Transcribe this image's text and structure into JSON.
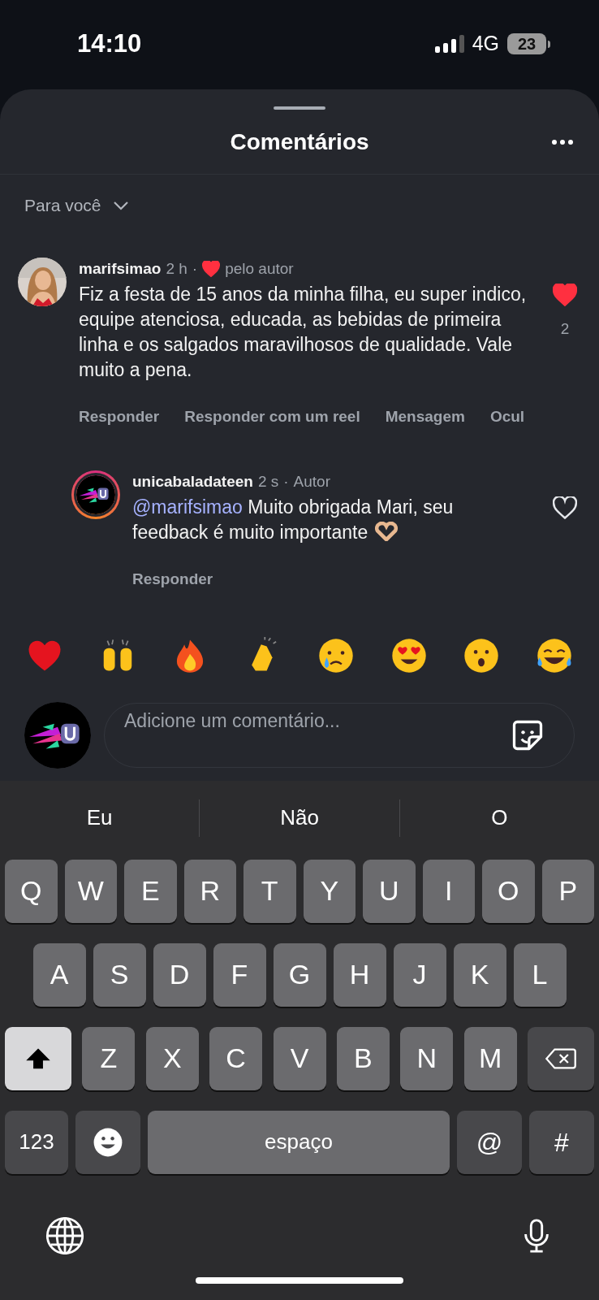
{
  "status_bar": {
    "time": "14:10",
    "network": "4G",
    "battery": "23"
  },
  "sheet": {
    "title": "Comentários",
    "filter": "Para você"
  },
  "comments": [
    {
      "kind": "comment",
      "username": "marifsimao",
      "time": "2 h",
      "sep": "·",
      "badge": "pelo autor",
      "badge_heart": true,
      "text": "Fiz a festa de 15 anos da minha filha, eu super indico, equipe atenciosa, educada, as bebidas de primeira linha e os salgados maravilhosos de qualidade. Vale muito a pena.",
      "liked": true,
      "likes": "2",
      "actions": [
        "Responder",
        "Responder com um reel",
        "Mensagem",
        "Ocul"
      ]
    },
    {
      "kind": "reply",
      "username": "unicabaladateen",
      "time": "2 s",
      "sep": "·",
      "badge": "Autor",
      "badge_heart": false,
      "mention": "@marifsimao",
      "text": "Muito obrigada Mari, seu feedback é muito importante",
      "liked": false,
      "actions": [
        "Responder"
      ]
    }
  ],
  "reactions": [
    {
      "kind": "heart"
    },
    {
      "kind": "raised-hands"
    },
    {
      "kind": "fire"
    },
    {
      "kind": "clap"
    },
    {
      "kind": "cry"
    },
    {
      "kind": "heart-eyes"
    },
    {
      "kind": "wow"
    },
    {
      "kind": "laugh"
    }
  ],
  "composer": {
    "placeholder": "Adicione um comentário..."
  },
  "keyboard": {
    "suggestions": [
      "Eu",
      "Não",
      "O"
    ],
    "shift_on": true,
    "rows": [
      {
        "keys": [
          {
            "kind": "letter",
            "label": "Q"
          },
          {
            "kind": "letter",
            "label": "W"
          },
          {
            "kind": "letter",
            "label": "E"
          },
          {
            "kind": "letter",
            "label": "R"
          },
          {
            "kind": "letter",
            "label": "T"
          },
          {
            "kind": "letter",
            "label": "Y"
          },
          {
            "kind": "letter",
            "label": "U"
          },
          {
            "kind": "letter",
            "label": "I"
          },
          {
            "kind": "letter",
            "label": "O"
          },
          {
            "kind": "letter",
            "label": "P"
          }
        ]
      },
      {
        "keys": [
          {
            "kind": "letter",
            "label": "A"
          },
          {
            "kind": "letter",
            "label": "S"
          },
          {
            "kind": "letter",
            "label": "D"
          },
          {
            "kind": "letter",
            "label": "F"
          },
          {
            "kind": "letter",
            "label": "G"
          },
          {
            "kind": "letter",
            "label": "H"
          },
          {
            "kind": "letter",
            "label": "J"
          },
          {
            "kind": "letter",
            "label": "K"
          },
          {
            "kind": "letter",
            "label": "L"
          }
        ]
      },
      {
        "keys": [
          {
            "kind": "shift"
          },
          {
            "kind": "letter",
            "label": "Z"
          },
          {
            "kind": "letter",
            "label": "X"
          },
          {
            "kind": "letter",
            "label": "C"
          },
          {
            "kind": "letter",
            "label": "V"
          },
          {
            "kind": "letter",
            "label": "B"
          },
          {
            "kind": "letter",
            "label": "N"
          },
          {
            "kind": "letter",
            "label": "M"
          },
          {
            "kind": "backspace"
          }
        ]
      },
      {
        "keys": [
          {
            "kind": "mode",
            "label": "123"
          },
          {
            "kind": "emoji"
          },
          {
            "kind": "space",
            "label": "espaço"
          },
          {
            "kind": "symbol",
            "label": "@"
          },
          {
            "kind": "symbol",
            "label": "#"
          }
        ]
      }
    ]
  }
}
